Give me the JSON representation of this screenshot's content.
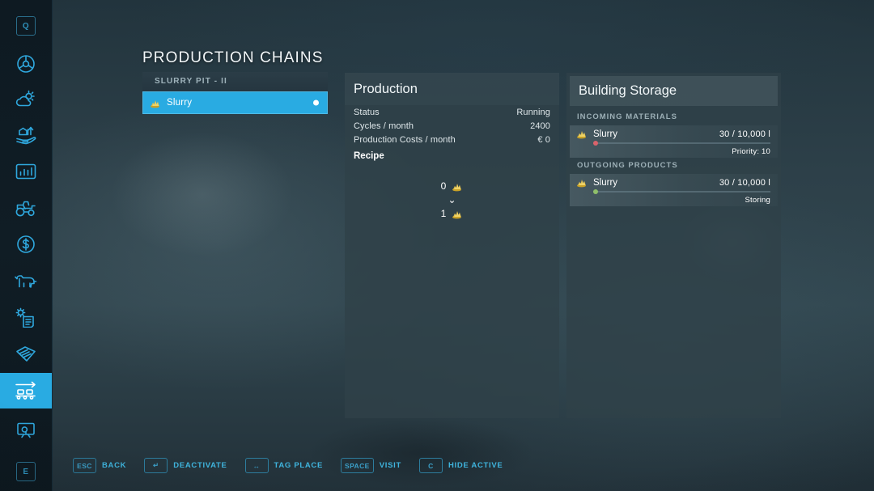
{
  "page_title": "PRODUCTION CHAINS",
  "colors": {
    "accent": "#29abe2",
    "panel_bg": "#2f4149",
    "background": "#2b3b43",
    "incoming_fill": "#d9636b",
    "outgoing_fill": "#8fbf6a",
    "help_text": "#3fb4dd"
  },
  "sidebar": {
    "items": [
      {
        "name": "key-q-hint",
        "icon": "keycap-q",
        "label": "Q",
        "active": false,
        "type": "keycap"
      },
      {
        "name": "vehicle-steering",
        "icon": "steering-wheel-icon",
        "label": "Vehicle",
        "active": false,
        "type": "icon"
      },
      {
        "name": "weather",
        "icon": "weather-sun-cloud-icon",
        "label": "Weather",
        "active": false,
        "type": "icon"
      },
      {
        "name": "finances-hand",
        "icon": "hand-growth-icon",
        "label": "Prices",
        "active": false,
        "type": "icon"
      },
      {
        "name": "statistics",
        "icon": "bar-chart-icon",
        "label": "Statistics",
        "active": false,
        "type": "icon"
      },
      {
        "name": "vehicles",
        "icon": "tractor-icon",
        "label": "Vehicles",
        "active": false,
        "type": "icon"
      },
      {
        "name": "finances",
        "icon": "dollar-circle-icon",
        "label": "Finances",
        "active": false,
        "type": "icon"
      },
      {
        "name": "animals",
        "icon": "cow-icon",
        "label": "Animals",
        "active": false,
        "type": "icon"
      },
      {
        "name": "contracts",
        "icon": "gear-document-icon",
        "label": "Contracts",
        "active": false,
        "type": "icon"
      },
      {
        "name": "documents",
        "icon": "documents-icon",
        "label": "Documents",
        "active": false,
        "type": "icon"
      },
      {
        "name": "production-chains",
        "icon": "conveyor-belt-icon",
        "label": "Production Chains",
        "active": true,
        "type": "icon"
      },
      {
        "name": "map-screen",
        "icon": "monitor-tree-icon",
        "label": "Map",
        "active": false,
        "type": "icon"
      },
      {
        "name": "key-e-hint",
        "icon": "keycap-e",
        "label": "E",
        "active": false,
        "type": "keycap"
      }
    ]
  },
  "chain_list": {
    "group_header": "SLURRY PIT   -  II",
    "rows": [
      {
        "label": "Slurry",
        "icon": "slurry-icon",
        "selected": true,
        "has_dot": true
      }
    ]
  },
  "production": {
    "title": "Production",
    "stats": [
      {
        "key": "Status",
        "value": "Running"
      },
      {
        "key": "Cycles / month",
        "value": "2400"
      },
      {
        "key": "Production Costs / month",
        "value": "€ 0"
      }
    ],
    "recipe_label": "Recipe",
    "recipe": {
      "input": {
        "amount": "0",
        "icon": "slurry-icon"
      },
      "arrow": "⌄",
      "output": {
        "amount": "1",
        "icon": "slurry-icon"
      }
    }
  },
  "building_storage": {
    "title": "Building Storage",
    "sections": [
      {
        "header": "INCOMING MATERIALS",
        "items": [
          {
            "name": "Slurry",
            "icon": "slurry-icon",
            "quantity": "30",
            "separator": "/",
            "capacity": "10,000 l",
            "sub_label": "Priority: 10",
            "fill_percent": 0.3,
            "fill_color": "#d9636b"
          }
        ]
      },
      {
        "header": "OUTGOING PRODUCTS",
        "items": [
          {
            "name": "Slurry",
            "icon": "slurry-icon",
            "quantity": "30",
            "separator": "/",
            "capacity": "10,000 l",
            "sub_label": "Storing",
            "fill_percent": 0.3,
            "fill_color": "#8fbf6a"
          }
        ]
      }
    ]
  },
  "help_bar": [
    {
      "key": "ESC",
      "label": "BACK"
    },
    {
      "key": "↵",
      "label": "DEACTIVATE"
    },
    {
      "key": "↔",
      "label": "TAG PLACE"
    },
    {
      "key": "SPACE",
      "label": "VISIT"
    },
    {
      "key": "C",
      "label": "HIDE ACTIVE"
    }
  ]
}
